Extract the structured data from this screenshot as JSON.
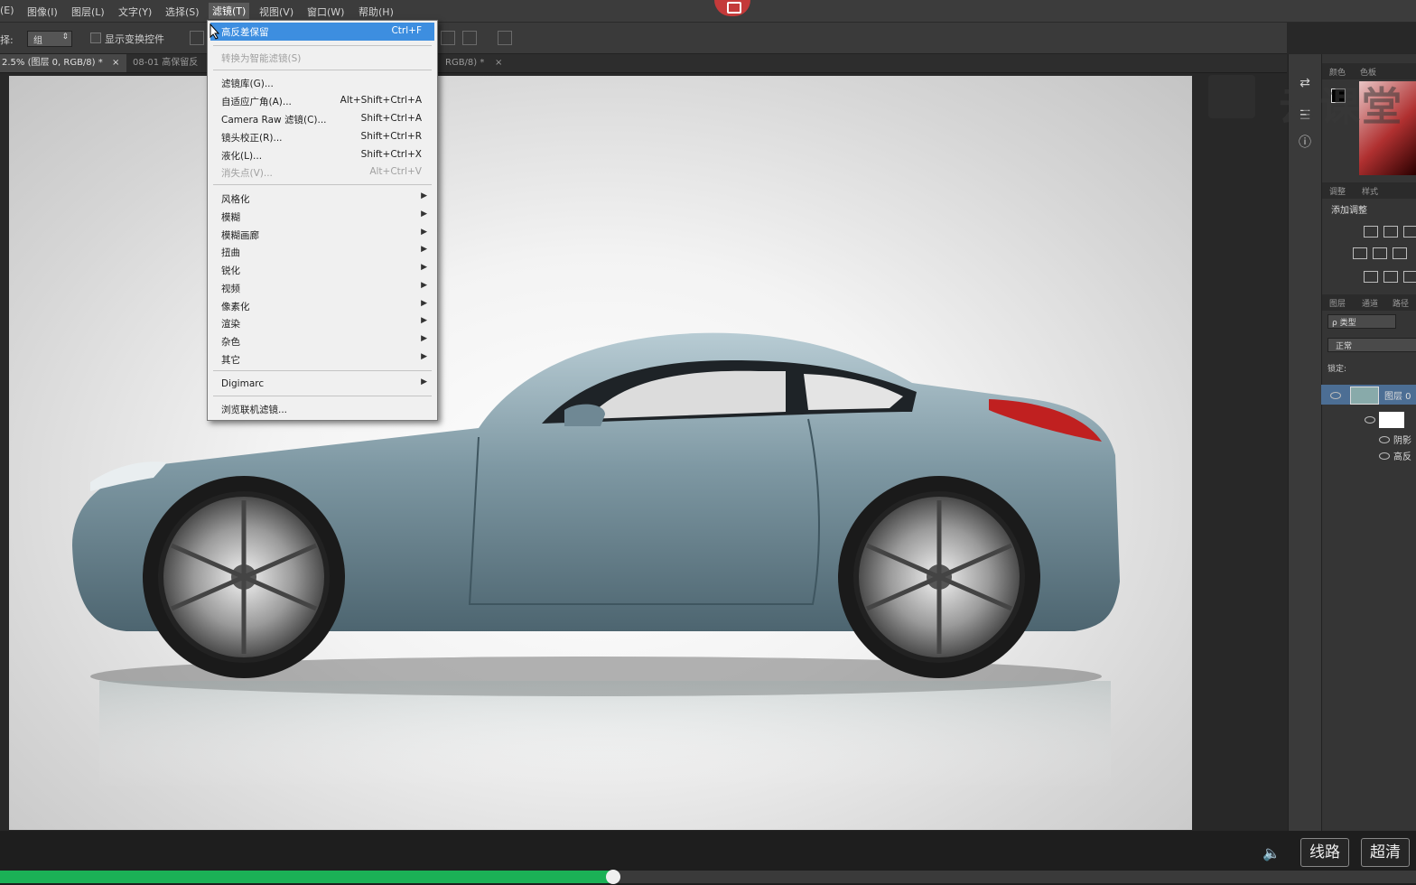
{
  "menubar": {
    "items": [
      "(E)",
      "图像(I)",
      "图层(L)",
      "文字(Y)",
      "选择(S)",
      "滤镜(T)",
      "视图(V)",
      "窗口(W)",
      "帮助(H)"
    ],
    "active_index": 5
  },
  "options": {
    "select_prefix": "择:",
    "select_value": "组",
    "checkbox_label": "显示变换控件"
  },
  "tabs": [
    "2.5% (图层 0, RGB/8) *",
    "08-01 高保留反",
    "RGB/8) *"
  ],
  "filter_menu": {
    "items": [
      {
        "label": "高反差保留",
        "shortcut": "Ctrl+F",
        "highlight": true
      },
      {
        "label": "转换为智能滤镜(S)",
        "disabled": true
      },
      {
        "label": "滤镜库(G)..."
      },
      {
        "label": "自适应广角(A)...",
        "shortcut": "Alt+Shift+Ctrl+A"
      },
      {
        "label": "Camera Raw 滤镜(C)...",
        "shortcut": "Shift+Ctrl+A"
      },
      {
        "label": "镜头校正(R)...",
        "shortcut": "Shift+Ctrl+R"
      },
      {
        "label": "液化(L)...",
        "shortcut": "Shift+Ctrl+X"
      },
      {
        "label": "消失点(V)...",
        "shortcut": "Alt+Ctrl+V",
        "disabled": true
      },
      {
        "label": "风格化",
        "submenu": true
      },
      {
        "label": "模糊",
        "submenu": true
      },
      {
        "label": "模糊画廊",
        "submenu": true
      },
      {
        "label": "扭曲",
        "submenu": true
      },
      {
        "label": "锐化",
        "submenu": true
      },
      {
        "label": "视频",
        "submenu": true
      },
      {
        "label": "像素化",
        "submenu": true
      },
      {
        "label": "渲染",
        "submenu": true
      },
      {
        "label": "杂色",
        "submenu": true
      },
      {
        "label": "其它",
        "submenu": true
      },
      {
        "label": "Digimarc",
        "submenu": true
      },
      {
        "label": "浏览联机滤镜..."
      }
    ]
  },
  "panels": {
    "color_tabs": [
      "颜色",
      "色板"
    ],
    "adjust_tabs": [
      "调整",
      "样式"
    ],
    "add_adjustment": "添加调整",
    "layers_tabs": [
      "图层",
      "通道",
      "路径"
    ],
    "filter_kind": "ρ 类型",
    "blend_mode": "正常",
    "lock_label": "锁定:",
    "layer_name": "图层 0",
    "effects": [
      "阴影",
      "高反"
    ]
  },
  "watermark": {
    "text": "云课堂"
  },
  "player": {
    "route_label": "线路",
    "quality_label": "超清",
    "progress": 0.433
  },
  "colors": {
    "accent_blue": "#3d8ee0",
    "progress_green": "#1bb156",
    "brand_red": "#c43a3a"
  }
}
